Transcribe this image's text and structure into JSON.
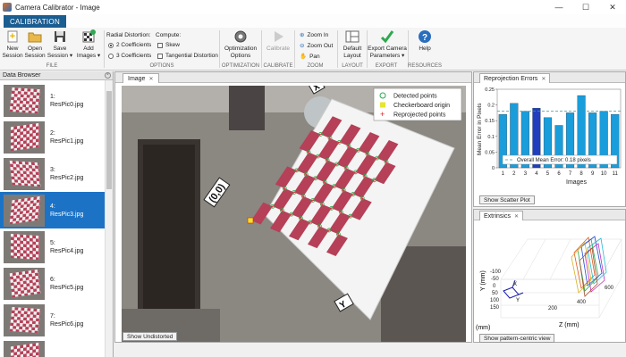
{
  "window": {
    "title": "Camera Calibrator - Image",
    "minimize": "—",
    "maximize": "☐",
    "close": "✕"
  },
  "tabs": {
    "calibration": "CALIBRATION"
  },
  "toolstrip": {
    "new_session": "New\nSession",
    "open_session": "Open\nSession",
    "save_session": "Save\nSession ▾",
    "add_images": "Add\nImages ▾",
    "radial_distortion": "Radial Distortion:",
    "two_coeff": "2 Coefficients",
    "three_coeff": "3 Coefficients",
    "compute": "Compute:",
    "skew": "Skew",
    "tangential": "Tangential Distortion",
    "optimization_options": "Optimization\nOptions",
    "calibrate": "Calibrate",
    "zoom_in": "Zoom In",
    "zoom_out": "Zoom Out",
    "pan": "Pan",
    "default_layout": "Default\nLayout",
    "export_camera": "Export Camera\nParameters ▾",
    "help": "Help",
    "groups": {
      "file": "FILE",
      "options": "OPTIONS",
      "optimization": "OPTIMIZATION",
      "calibrate": "CALIBRATE",
      "zoom": "ZOOM",
      "layout": "LAYOUT",
      "export": "EXPORT",
      "resources": "RESOURCES"
    }
  },
  "data_browser": {
    "title": "Data Browser",
    "items": [
      {
        "num": "1:",
        "name": "ResPic0.jpg"
      },
      {
        "num": "2:",
        "name": "ResPic1.jpg"
      },
      {
        "num": "3:",
        "name": "ResPic2.jpg"
      },
      {
        "num": "4:",
        "name": "ResPic3.jpg"
      },
      {
        "num": "5:",
        "name": "ResPic4.jpg"
      },
      {
        "num": "6:",
        "name": "ResPic5.jpg"
      },
      {
        "num": "7:",
        "name": "ResPic6.jpg"
      },
      {
        "num": "",
        "name": ""
      }
    ],
    "selected_index": 3
  },
  "image_panel": {
    "tab": "Image",
    "legend": [
      "Detected points",
      "Checkerboard origin",
      "Reprojected points"
    ],
    "origin_label": "(0,0)",
    "x_label": "X",
    "y_label": "Y",
    "show_undistorted": "Show Undistorted"
  },
  "reprojection": {
    "tab": "Reprojection Errors",
    "ylabel": "Mean Error in Pixels",
    "xlabel": "Images",
    "legend": "Overall Mean Error: 0.18 pixels",
    "button": "Show Scatter Plot"
  },
  "extrinsics": {
    "tab": "Extrinsics",
    "y_axis": "Y (mm)",
    "z_axis": "Z (mm)",
    "x_axis": "(mm)",
    "button": "Show pattern-centric view",
    "x_label": "X",
    "y_label": "Y"
  },
  "colors": {
    "accent": "#1c73c6",
    "selected_bar": "#1f3fbf",
    "bar": "#1a9ddb",
    "board_red": "#b54057"
  },
  "chart_data": {
    "type": "bar",
    "categories": [
      "1",
      "2",
      "3",
      "4",
      "5",
      "6",
      "7",
      "8",
      "9",
      "10",
      "11"
    ],
    "values": [
      0.17,
      0.205,
      0.18,
      0.19,
      0.16,
      0.135,
      0.175,
      0.23,
      0.175,
      0.18,
      0.17
    ],
    "highlight_index": 3,
    "mean": 0.18,
    "ylim": [
      0,
      0.25
    ],
    "yticks": [
      "0",
      "0.05",
      "0.1",
      "0.15",
      "0.2",
      "0.25"
    ],
    "title": "",
    "xlabel": "Images",
    "ylabel": "Mean Error in Pixels"
  },
  "extrinsics_ticks": {
    "z": [
      "200",
      "400",
      "600"
    ],
    "y": [
      "-100",
      "-50",
      "0",
      "50",
      "100",
      "150"
    ]
  }
}
